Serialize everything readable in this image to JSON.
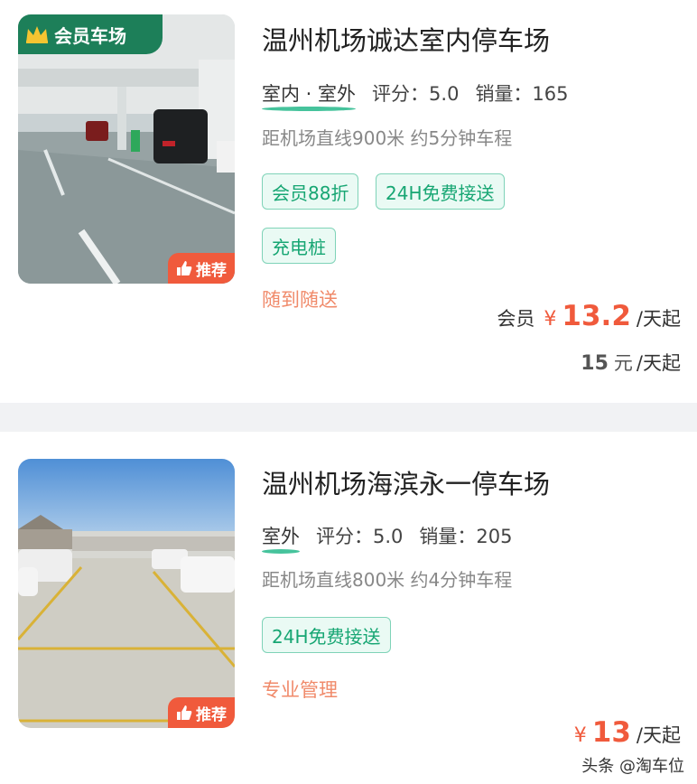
{
  "listings": [
    {
      "member_badge": "会员车场",
      "recommend_badge": "推荐",
      "title": "温州机场诚达室内停车场",
      "type": "室内 · 室外",
      "rating": "评分：5.0",
      "sales": "销量：165",
      "distance": "距机场直线900米 约5分钟车程",
      "chips": [
        "会员88折",
        "24H免费接送",
        "充电桩"
      ],
      "promo": "随到随送",
      "member_label": "会员",
      "member_price": "13.2",
      "unit": "/天起",
      "regular_price": "15",
      "regular_unit": "元"
    },
    {
      "recommend_badge": "推荐",
      "title": "温州机场海滨永一停车场",
      "type": "室外",
      "rating": "评分：5.0",
      "sales": "销量：205",
      "distance": "距机场直线800米 约4分钟车程",
      "chips": [
        "24H免费接送"
      ],
      "promo": "专业管理",
      "price": "13",
      "unit": "/天起"
    }
  ],
  "currency": "¥",
  "watermark": "头条 @淘车位",
  "icons": [
    "crown-icon",
    "thumbs-up-icon"
  ],
  "colors": {
    "accent": "#f05a3c",
    "green": "#17a673",
    "badge": "#1d7f59"
  }
}
